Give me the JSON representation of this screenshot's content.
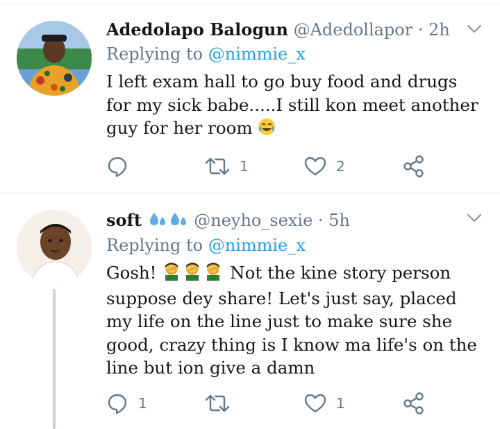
{
  "tweets": [
    {
      "display_name": "Adedolapo Balogun",
      "handle": "@Adedollapor",
      "separator": "·",
      "time": "2h",
      "replying_prefix": "Replying to",
      "replying_to": "@nimmie_x",
      "text": "I left exam hall to go buy food and drugs for my sick babe.....I still kon meet another guy for her room",
      "emoji": "face-with-tears-of-joy",
      "reply_count": "",
      "retweet_count": "1",
      "like_count": "2"
    },
    {
      "display_name": "soft",
      "name_emoji": "sweat-droplets",
      "handle": "@neyho_sexie",
      "separator": "·",
      "time": "5h",
      "replying_prefix": "Replying to",
      "replying_to": "@nimmie_x",
      "text_start": "Gosh!",
      "inline_emoji": "man-facepalming",
      "text_rest": "Not the kine story person suppose dey share! Let's just say, placed my life on the line just to make sure she good, crazy thing is I know ma life's on the line but ion give a damn",
      "reply_count": "1",
      "retweet_count": "",
      "like_count": "1"
    }
  ],
  "colors": {
    "text": "#14171a",
    "secondary": "#657786",
    "link": "#1da1f2",
    "icon": "#657786"
  }
}
